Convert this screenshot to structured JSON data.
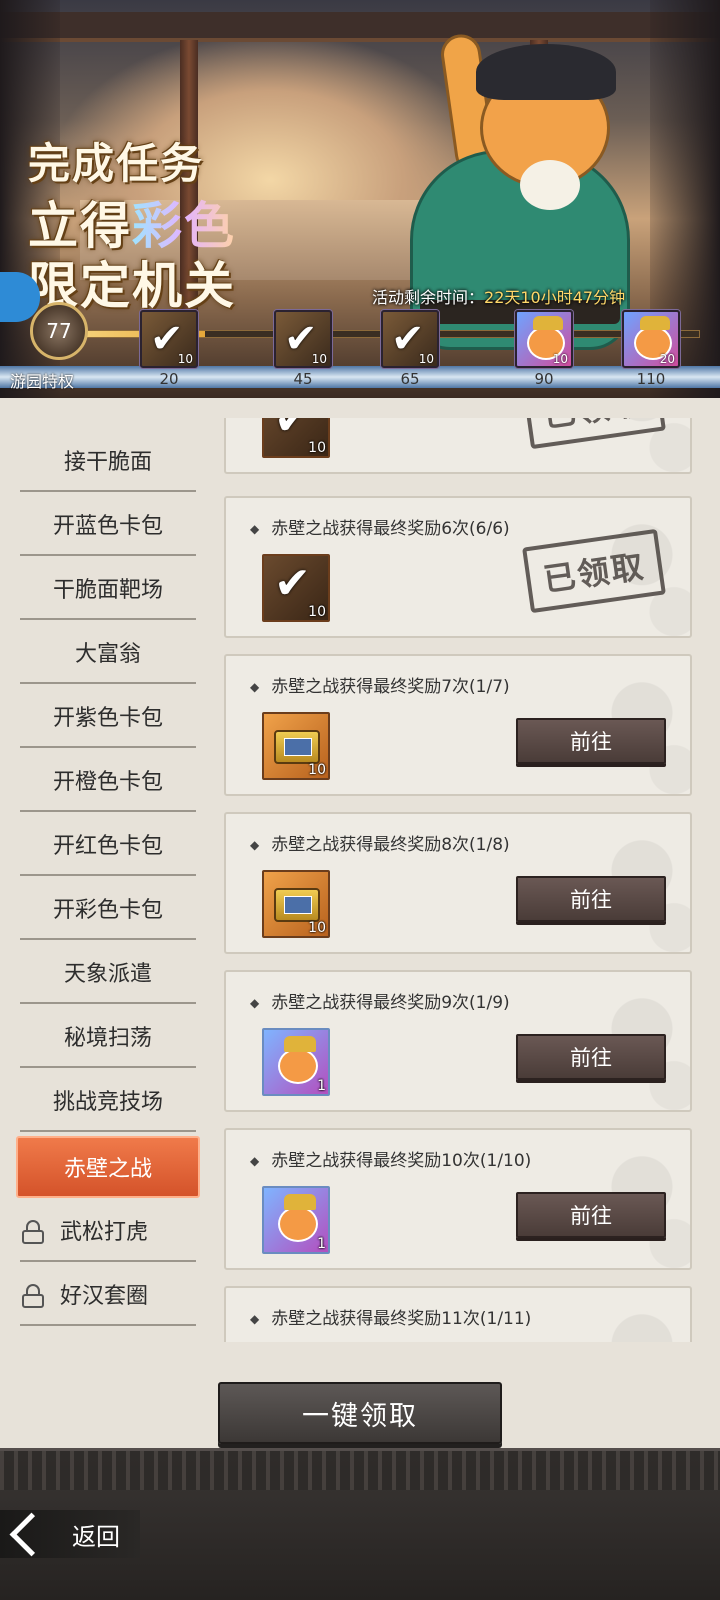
{
  "banner": {
    "slogan_line1": "完成任务",
    "slogan_line2_a": "立得",
    "slogan_line2_b": "彩色",
    "slogan_line3": "限定机关",
    "timer_label": "活动剩余时间：",
    "timer_value": "22天10小时47分钟",
    "level": "77",
    "privilege_label": "游园特权",
    "progress_fraction": 0.2,
    "milestones": [
      {
        "threshold": "20",
        "count": "10",
        "icon": "box-claimed-icon"
      },
      {
        "threshold": "45",
        "count": "10",
        "icon": "box-claimed-icon"
      },
      {
        "threshold": "65",
        "count": "10",
        "icon": "box-claimed-icon"
      },
      {
        "threshold": "90",
        "count": "10",
        "icon": "cat-card-icon"
      },
      {
        "threshold": "110",
        "count": "20",
        "icon": "cat-card-icon"
      }
    ]
  },
  "sidebar": {
    "items": [
      {
        "label": "接干脆面"
      },
      {
        "label": "开蓝色卡包"
      },
      {
        "label": "干脆面靶场"
      },
      {
        "label": "大富翁"
      },
      {
        "label": "开紫色卡包"
      },
      {
        "label": "开橙色卡包"
      },
      {
        "label": "开红色卡包"
      },
      {
        "label": "开彩色卡包"
      },
      {
        "label": "天象派遣"
      },
      {
        "label": "秘境扫荡"
      },
      {
        "label": "挑战竞技场"
      },
      {
        "label": "赤壁之战"
      },
      {
        "label": "武松打虎"
      },
      {
        "label": "好汉套圈"
      }
    ],
    "active_index": 11
  },
  "tasks": [
    {
      "title": "",
      "reward_qty": "10",
      "status": "claimed",
      "stamp": "已领取"
    },
    {
      "title": "赤壁之战获得最终奖励6次(6/6)",
      "reward_qty": "10",
      "status": "claimed",
      "stamp": "已领取"
    },
    {
      "title": "赤壁之战获得最终奖励7次(1/7)",
      "reward_qty": "10",
      "status": "go",
      "button": "前往"
    },
    {
      "title": "赤壁之战获得最终奖励8次(1/8)",
      "reward_qty": "10",
      "status": "go",
      "button": "前往"
    },
    {
      "title": "赤壁之战获得最终奖励9次(1/9)",
      "reward_qty": "1",
      "status": "go",
      "button": "前往"
    },
    {
      "title": "赤壁之战获得最终奖励10次(1/10)",
      "reward_qty": "1",
      "status": "go",
      "button": "前往"
    },
    {
      "title": "赤壁之战获得最终奖励11次(1/11)",
      "reward_qty": "",
      "status": "go",
      "button": ""
    }
  ],
  "claim_all_label": "一键领取",
  "back_label": "返回"
}
